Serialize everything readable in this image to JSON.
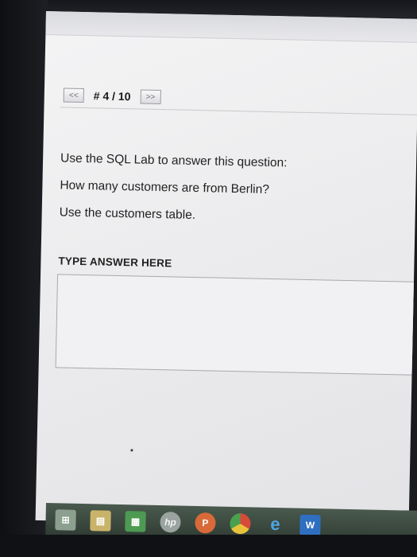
{
  "nav": {
    "prev_label": "<<",
    "counter": "# 4 / 10",
    "next_label": ">>"
  },
  "question": {
    "line1": "Use the SQL Lab to answer this question:",
    "line2": "How many customers are from Berlin?",
    "line3": "Use the customers table."
  },
  "answer": {
    "label": "TYPE ANSWER HERE",
    "value": ""
  },
  "taskbar": {
    "items": [
      {
        "icon": "windows-start-icon"
      },
      {
        "icon": "file-explorer-icon"
      },
      {
        "icon": "store-icon"
      },
      {
        "icon": "hp-icon",
        "label": "hp"
      },
      {
        "icon": "powerpoint-icon",
        "label": "P"
      },
      {
        "icon": "chrome-icon"
      },
      {
        "icon": "internet-explorer-icon",
        "label": "e"
      },
      {
        "icon": "word-icon",
        "label": "W"
      }
    ]
  }
}
